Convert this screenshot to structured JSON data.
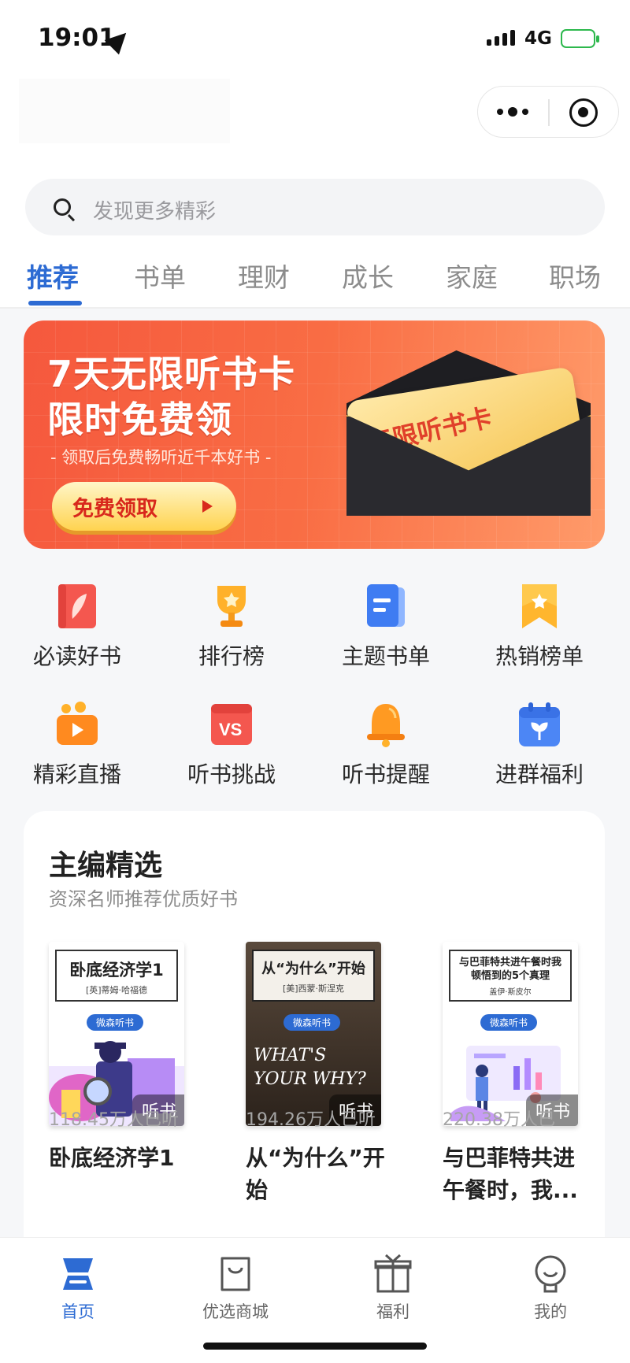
{
  "status_bar": {
    "time": "19:01",
    "network": "4G"
  },
  "search": {
    "placeholder": "发现更多精彩"
  },
  "tabs": [
    {
      "label": "推荐",
      "active": true
    },
    {
      "label": "书单"
    },
    {
      "label": "理财"
    },
    {
      "label": "成长"
    },
    {
      "label": "家庭"
    },
    {
      "label": "职场"
    }
  ],
  "banner": {
    "title_line1": "7天无限听书卡",
    "title_line2": "限时免费领",
    "subtitle": "- 领取后免费畅听近千本好书 -",
    "button": "免费领取",
    "card_text": "无限听书卡"
  },
  "grid": [
    {
      "label": "必读好书",
      "icon": "feather-book-icon"
    },
    {
      "label": "排行榜",
      "icon": "trophy-icon"
    },
    {
      "label": "主题书单",
      "icon": "document-list-icon"
    },
    {
      "label": "热销榜单",
      "icon": "star-bookmark-icon"
    },
    {
      "label": "精彩直播",
      "icon": "live-video-icon"
    },
    {
      "label": "听书挑战",
      "icon": "vs-challenge-icon"
    },
    {
      "label": "听书提醒",
      "icon": "bell-icon"
    },
    {
      "label": "进群福利",
      "icon": "calendar-sprout-icon"
    }
  ],
  "editor_picks": {
    "title": "主编精选",
    "subtitle": "资深名师推荐优质好书",
    "books": [
      {
        "title": "卧底经济学1",
        "cover_title": "卧底经济学1",
        "cover_author": "[英]蒂姆·哈福德",
        "badge": "微森听书",
        "tag": "听书",
        "listeners": "118.45万人已听"
      },
      {
        "title": "从“为什么”开始",
        "cover_title": "从“为什么”开始",
        "cover_author": "[美]西蒙·斯涅克",
        "badge": "微森听书",
        "cover_art": "WHAT'S YOUR WHY?",
        "tag": "听书",
        "listeners": "194.26万人已听"
      },
      {
        "title": "与巴菲特共进午餐时，我...",
        "cover_title": "与巴菲特共进午餐时我顿悟到的5个真理",
        "cover_author": "盖伊·斯皮尔",
        "badge": "微森听书",
        "tag": "听书",
        "listeners": "220.38万人已"
      }
    ]
  },
  "tabbar": [
    {
      "label": "首页",
      "active": true
    },
    {
      "label": "优选商城"
    },
    {
      "label": "福利"
    },
    {
      "label": "我的"
    }
  ],
  "colors": {
    "accent": "#2d6bd3",
    "banner": "#f5583d"
  }
}
